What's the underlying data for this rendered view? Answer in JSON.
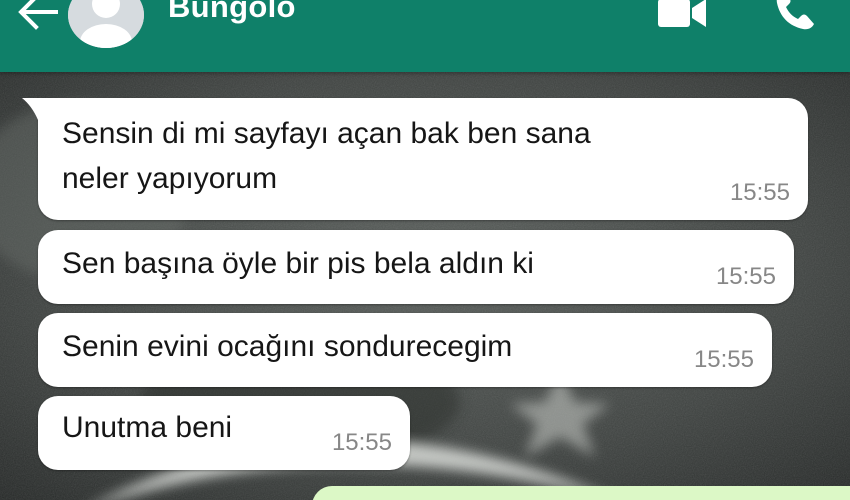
{
  "header": {
    "contact_name": "Bungolo",
    "back_icon": "arrow-left-icon",
    "avatar_icon": "default-person-avatar",
    "video_icon": "video-camera-icon",
    "call_icon": "phone-icon",
    "background_color": "#0f8069"
  },
  "messages": [
    {
      "lines": [
        "Sensin di mi sayfayı açan bak ben sana",
        "neler yapıyorum"
      ],
      "time": "15:55"
    },
    {
      "lines": [
        "Sen başına öyle bir pis bela aldın ki"
      ],
      "time": "15:55"
    },
    {
      "lines": [
        "Senin evini ocağını sondurecegim"
      ],
      "time": "15:55"
    },
    {
      "lines": [
        "Unutma beni"
      ],
      "time": "15:55"
    }
  ],
  "colors": {
    "incoming_bubble": "#ffffff",
    "outgoing_bubble": "#dcf8c6",
    "timestamp": "#878787"
  }
}
